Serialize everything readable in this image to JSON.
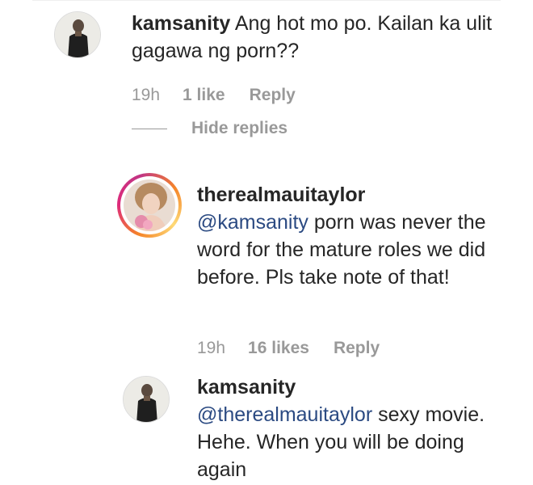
{
  "comments": [
    {
      "username": "kamsanity",
      "text": "Ang hot mo po. Kailan ka ulit gagawa ng porn??",
      "time": "19h",
      "likes": "1 like",
      "reply": "Reply"
    }
  ],
  "hide_replies": "Hide replies",
  "replies": [
    {
      "username": "therealmauitaylor",
      "mention": "@kamsanity",
      "text": "porn was never the word for the mature roles we did before. Pls take note of that!",
      "time": "19h",
      "likes": "16 likes",
      "reply": "Reply"
    },
    {
      "username": "kamsanity",
      "mention": "@therealmauitaylor",
      "text": "sexy movie. Hehe. When you will be doing again"
    }
  ],
  "colors": {
    "text": "#262626",
    "meta": "#999999",
    "mention": "#2b4a82",
    "story_ring_start": "#f58529",
    "story_ring_mid": "#dd2a7b"
  }
}
